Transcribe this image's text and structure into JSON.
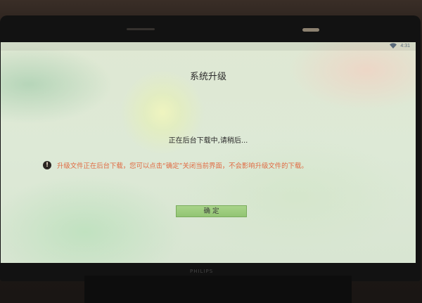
{
  "status_bar": {
    "time": "4:31",
    "wifi_icon": "wifi-icon"
  },
  "dialog": {
    "title": "系统升级",
    "status_message": "正在后台下载中,请稍后...",
    "notice_icon": "warning-icon",
    "notice_glyph": "!",
    "notice_text": "升级文件正在后台下载，您可以点击“确定”关闭当前界面，不会影响升级文件的下载。",
    "confirm_label": "确  定"
  },
  "colors": {
    "notice_text": "#e06a42",
    "confirm_button": "#9ccc7d",
    "title_text": "#2c2c2c"
  }
}
